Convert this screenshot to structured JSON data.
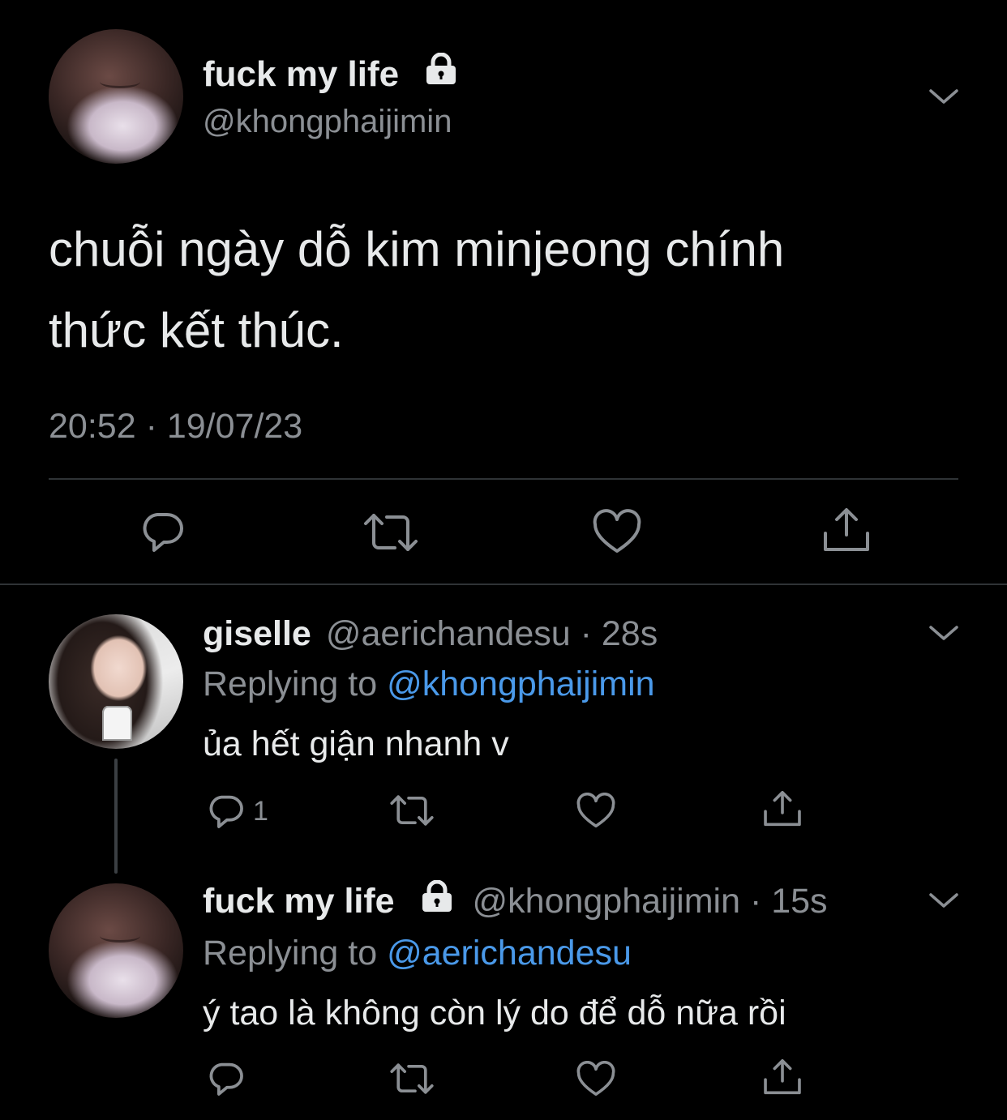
{
  "main_tweet": {
    "display_name": "fuck my life",
    "handle": "@khongphaijimin",
    "text_line1": "chuỗi ngày dỗ kim minjeong chính",
    "text_line2": "thức kết thúc.",
    "time": "20:52",
    "separator": "·",
    "date": "19/07/23"
  },
  "reply1": {
    "display_name": "giselle",
    "handle": "@aerichandesu",
    "age": "· 28s",
    "replying_prefix": "Replying to ",
    "replying_to": "@khongphaijimin",
    "text": "ủa hết giận nhanh v",
    "reply_count": "1"
  },
  "reply2": {
    "display_name": "fuck my life",
    "handle": "@khongphaijimin",
    "age": "· 15s",
    "replying_prefix": "Replying to ",
    "replying_to": "@aerichandesu",
    "text": "ý tao là không còn lý do để dỗ nữa rồi"
  },
  "colors": {
    "background": "#000000",
    "text": "#e7e9ea",
    "muted": "#8b8f94",
    "link": "#4a99e9",
    "divider": "#2f3336"
  },
  "icons": [
    "lock-icon",
    "chevron-down-icon",
    "reply-icon",
    "retweet-icon",
    "like-icon",
    "share-icon"
  ]
}
